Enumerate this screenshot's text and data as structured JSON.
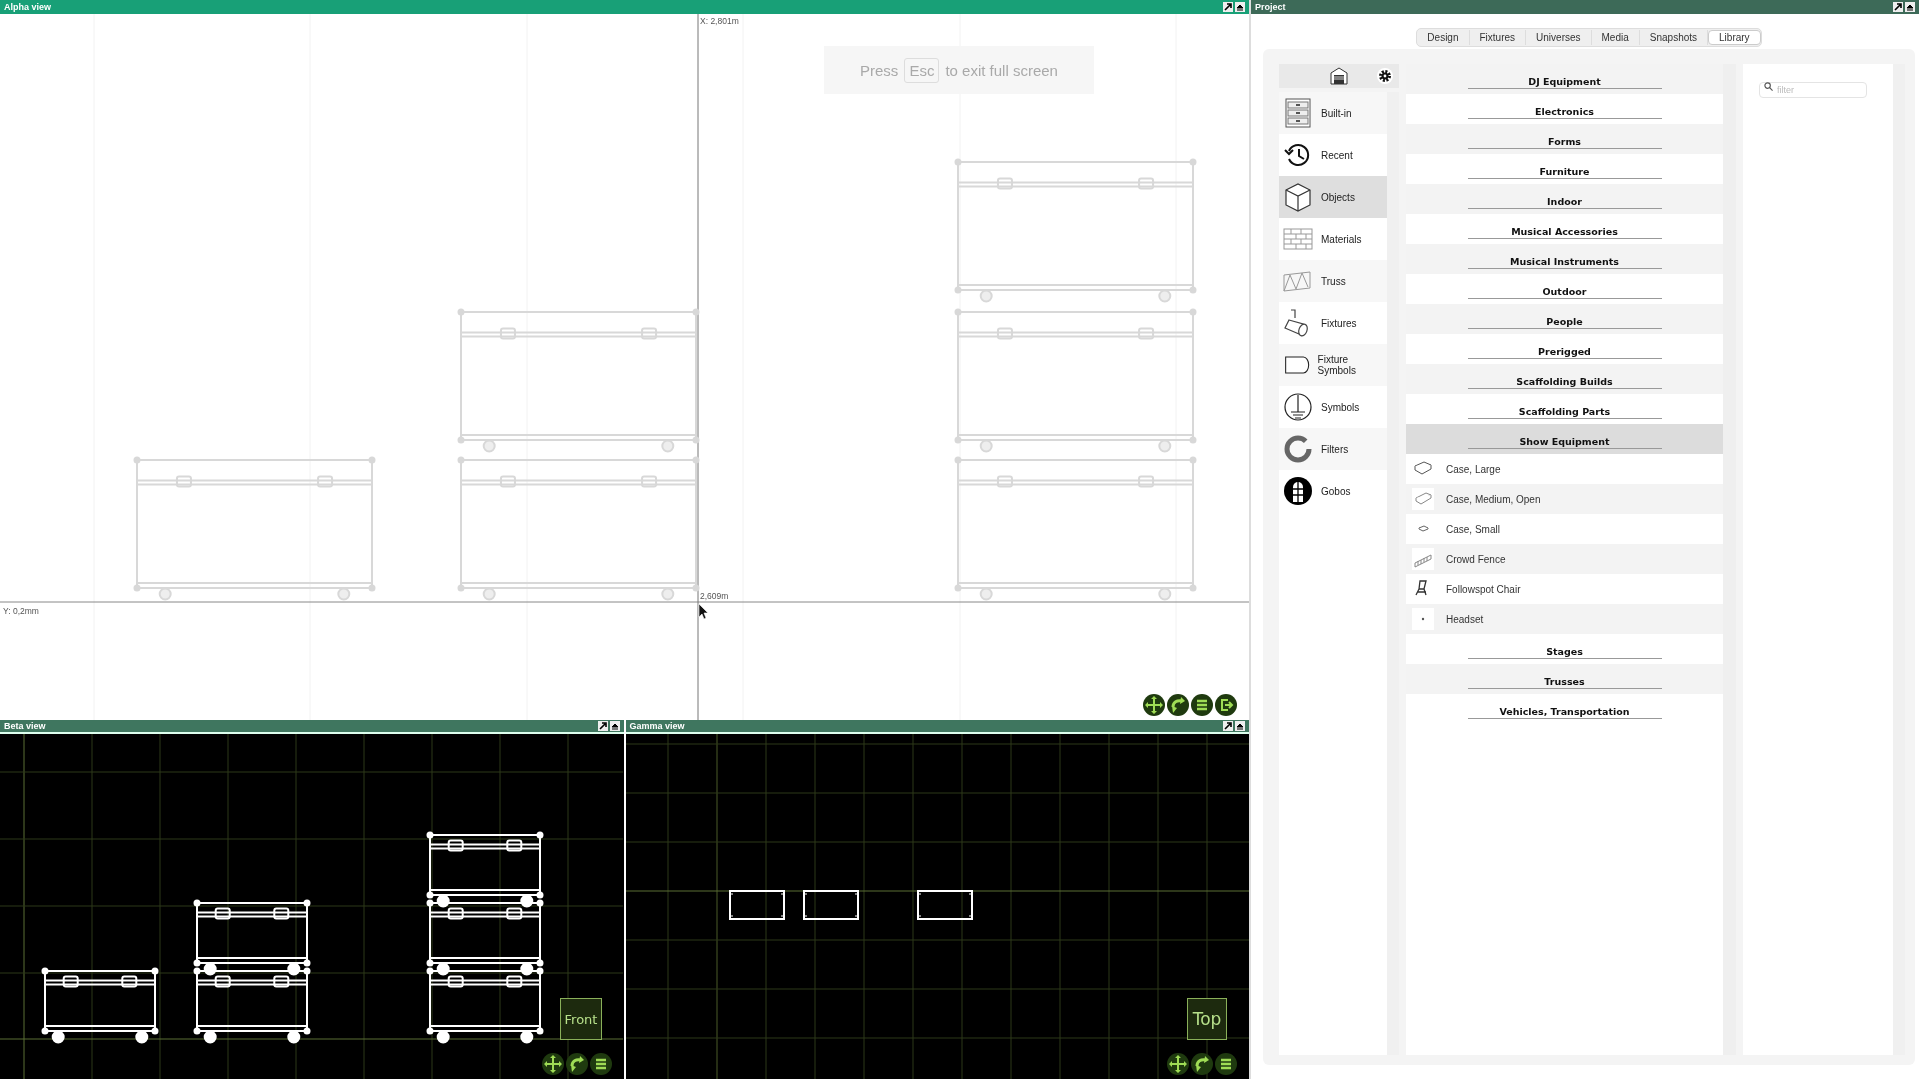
{
  "alpha_view": {
    "title": "Alpha view",
    "x_readout": "X: 2,801m",
    "height_readout": "2,609m",
    "y_readout": "Y: 0,2mm",
    "fullscreen_hint": {
      "before": "Press",
      "key": "Esc",
      "after": "to exit full screen"
    }
  },
  "beta_view": {
    "title": "Beta view",
    "view_label": "Front"
  },
  "gamma_view": {
    "title": "Gamma view",
    "view_label": "Top"
  },
  "project": {
    "title": "Project",
    "tabs": [
      {
        "label": "Design",
        "selected": false
      },
      {
        "label": "Fixtures",
        "selected": false
      },
      {
        "label": "Universes",
        "selected": false
      },
      {
        "label": "Media",
        "selected": false
      },
      {
        "label": "Snapshots",
        "selected": false
      },
      {
        "label": "Library",
        "selected": true
      }
    ],
    "categories": [
      {
        "label": "Built-in",
        "selected": false
      },
      {
        "label": "Recent",
        "selected": false
      },
      {
        "label": "Objects",
        "selected": true
      },
      {
        "label": "Materials",
        "selected": false
      },
      {
        "label": "Truss",
        "selected": false
      },
      {
        "label": "Fixtures",
        "selected": false
      },
      {
        "label": "Fixture Symbols",
        "selected": false
      },
      {
        "label": "Symbols",
        "selected": false
      },
      {
        "label": "Filters",
        "selected": false
      },
      {
        "label": "Gobos",
        "selected": false
      }
    ],
    "library": [
      {
        "label": "DJ Equipment",
        "expanded": false
      },
      {
        "label": "Electronics",
        "expanded": false
      },
      {
        "label": "Forms",
        "expanded": false
      },
      {
        "label": "Furniture",
        "expanded": false
      },
      {
        "label": "Indoor",
        "expanded": false
      },
      {
        "label": "Musical Accessories",
        "expanded": false
      },
      {
        "label": "Musical Instruments",
        "expanded": false
      },
      {
        "label": "Outdoor",
        "expanded": false
      },
      {
        "label": "People",
        "expanded": false
      },
      {
        "label": "Prerigged",
        "expanded": false
      },
      {
        "label": "Scaffolding Builds",
        "expanded": false
      },
      {
        "label": "Scaffolding Parts",
        "expanded": false
      },
      {
        "label": "Show Equipment",
        "expanded": true,
        "children": [
          {
            "label": "Case, Large"
          },
          {
            "label": "Case, Medium, Open"
          },
          {
            "label": "Case, Small"
          },
          {
            "label": "Crowd Fence"
          },
          {
            "label": "Followspot Chair"
          },
          {
            "label": "Headset"
          }
        ]
      },
      {
        "label": "Stages",
        "expanded": false
      },
      {
        "label": "Trusses",
        "expanded": false
      },
      {
        "label": "Vehicles, Transportation",
        "expanded": false
      }
    ],
    "filter": {
      "placeholder": "filter"
    }
  }
}
